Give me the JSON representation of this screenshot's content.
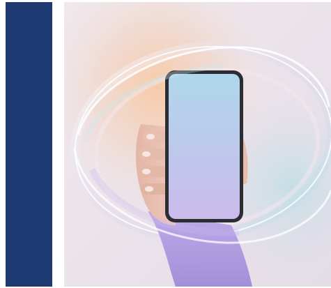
{
  "theme": {
    "sidebar_color": "#1e3a73",
    "hero_background": "#ece5ea",
    "phone_frame_color": "#2b2d33",
    "screen_top_color": "#a9d4ea",
    "screen_bottom_color": "#c6b6ea"
  },
  "hero": {
    "image_subject": "hand-holding-phone-icon"
  }
}
